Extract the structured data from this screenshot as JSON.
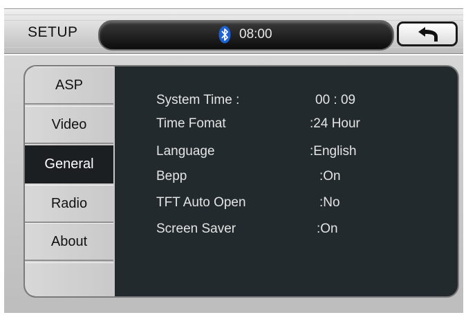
{
  "header": {
    "title": "SETUP",
    "time": "08:00",
    "bluetooth_icon": "bluetooth-icon",
    "back_icon": "back-arrow-icon"
  },
  "tabs": [
    {
      "label": "ASP",
      "active": false
    },
    {
      "label": "Video",
      "active": false
    },
    {
      "label": "General",
      "active": true
    },
    {
      "label": "Radio",
      "active": false
    },
    {
      "label": "About",
      "active": false
    }
  ],
  "settings": [
    {
      "label": "System Time  :",
      "value": "00 : 09"
    },
    {
      "label": "Time Fomat",
      "value": ":24 Hour"
    },
    {
      "label": "Language",
      "value": ":English"
    },
    {
      "label": "Bepp",
      "value": ":On"
    },
    {
      "label": "TFT Auto Open",
      "value": ":No"
    },
    {
      "label": "Screen Saver",
      "value": ":On"
    }
  ],
  "colors": {
    "panel_background": "#232a2e",
    "active_tab": "#1b1f22",
    "bluetooth_blue": "#1e63d6"
  }
}
